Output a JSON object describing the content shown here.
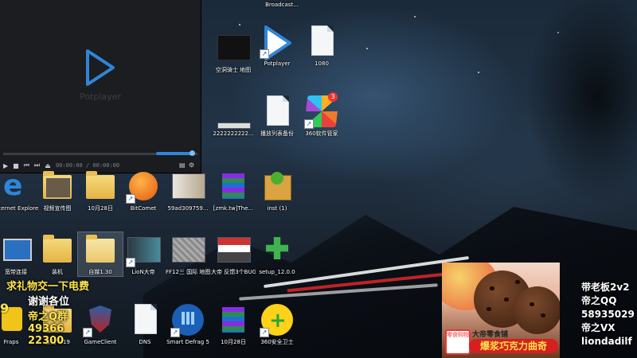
{
  "player": {
    "watermark": "Potplayer",
    "time_current": "00:00:00",
    "time_separator": "/",
    "time_total": "00:00:00"
  },
  "icons": [
    {
      "id": "top1",
      "label": "Broadcast..."
    },
    {
      "id": "kongjian",
      "label": "空洞骑士 地图"
    },
    {
      "id": "potplayer",
      "label": "Potplayer"
    },
    {
      "id": "file1080",
      "label": "1080"
    },
    {
      "id": "num2222",
      "label": "2222222222..."
    },
    {
      "id": "playlist",
      "label": "播放列表备份"
    },
    {
      "id": "soft360",
      "label": "360软件管家",
      "badge": "3"
    },
    {
      "id": "ie",
      "label": "Internet Explorer"
    },
    {
      "id": "video",
      "label": "视频宣传图"
    },
    {
      "id": "oct28a",
      "label": "10月28日"
    },
    {
      "id": "bitcomet",
      "label": "BitComet"
    },
    {
      "id": "img59",
      "label": "59ad309759..."
    },
    {
      "id": "zmk",
      "label": "[zmk.tw]The..."
    },
    {
      "id": "inst",
      "label": "inst (1)"
    },
    {
      "id": "netconn",
      "label": "宽带连接"
    },
    {
      "id": "zhuangji",
      "label": "装机"
    },
    {
      "id": "fold130",
      "label": "自媒1.30"
    },
    {
      "id": "lion",
      "label": "LioN大帝"
    },
    {
      "id": "ff12",
      "label": "FF12三 国际 地图 (1)"
    },
    {
      "id": "bug",
      "label": "大帝 反馈3个BUG问题"
    },
    {
      "id": "setup",
      "label": "setup_12.0.0"
    },
    {
      "id": "fraps",
      "label": "Fraps"
    },
    {
      "id": "zj919",
      "label": "装机 9 19"
    },
    {
      "id": "gameclient",
      "label": "GameClient"
    },
    {
      "id": "dns",
      "label": "DNS"
    },
    {
      "id": "defrag",
      "label": "Smart Defrag 5"
    },
    {
      "id": "oct28b",
      "label": "10月28日"
    },
    {
      "id": "safe360",
      "label": "360安全卫士"
    }
  ],
  "overlay": {
    "gift_line1": "求礼物交一下电费",
    "gift_line2": "谢谢各位",
    "gift_line3": "帝之Q群",
    "gift_num1": "49366",
    "gift_num2": "22300",
    "left_number": "9",
    "contact": [
      "带老板2v2",
      "帝之QQ",
      "58935029",
      "帝之VX",
      "liondadilf"
    ]
  },
  "ad": {
    "shop_label": "大帝零食铺",
    "banner": "爆浆巧克力曲奇",
    "mini_label": "零食购物"
  },
  "colors": {
    "accent_blue": "#2f86d8",
    "gift_yellow": "#ffe44d",
    "ad_red": "#d61f1f"
  }
}
